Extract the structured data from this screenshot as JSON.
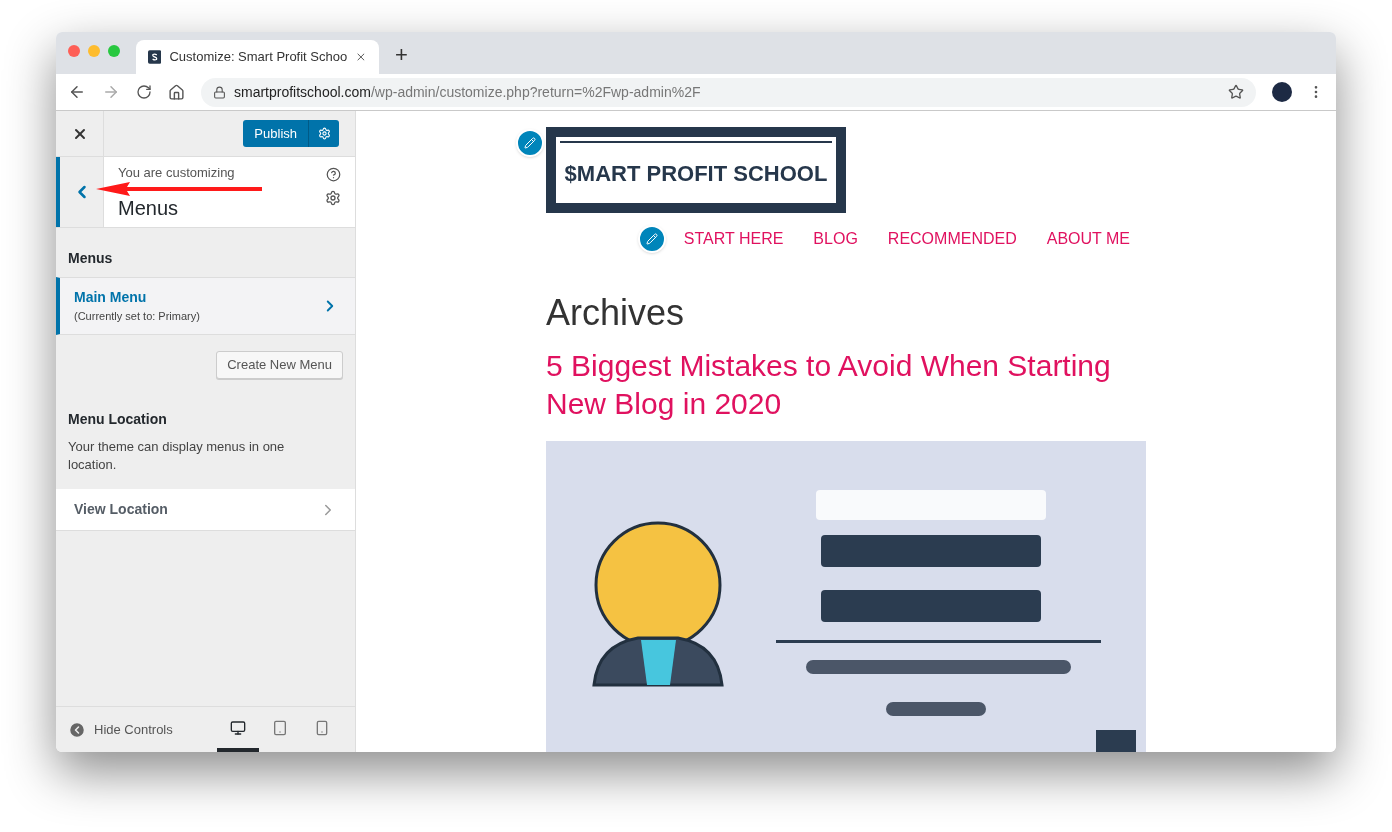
{
  "browser": {
    "tab_title": "Customize: Smart Profit Schoo",
    "new_tab": "+",
    "url_host": "smartprofitschool.com",
    "url_path": "/wp-admin/customize.php?return=%2Fwp-admin%2F"
  },
  "customizer": {
    "publish": "Publish",
    "customizing_label": "You are customizing",
    "panel_title": "Menus",
    "section_heading": "Menus",
    "menus": [
      {
        "name": "Main Menu",
        "note": "(Currently set to: Primary)",
        "selected": true
      }
    ],
    "create_button": "Create New Menu",
    "location_heading": "Menu Location",
    "location_text": "Your theme can display menus in one location.",
    "view_location": "View Location",
    "hide_controls": "Hide Controls",
    "devices": [
      {
        "kind": "desktop",
        "selected": true
      },
      {
        "kind": "tablet",
        "selected": false
      },
      {
        "kind": "mobile",
        "selected": false
      }
    ]
  },
  "preview": {
    "logo": "$MART PROFIT SCHOOL",
    "nav": [
      "START HERE",
      "BLOG",
      "RECOMMENDED",
      "ABOUT ME"
    ],
    "heading": "Archives",
    "post_title": "5 Biggest Mistakes to Avoid When Starting New Blog in 2020"
  }
}
